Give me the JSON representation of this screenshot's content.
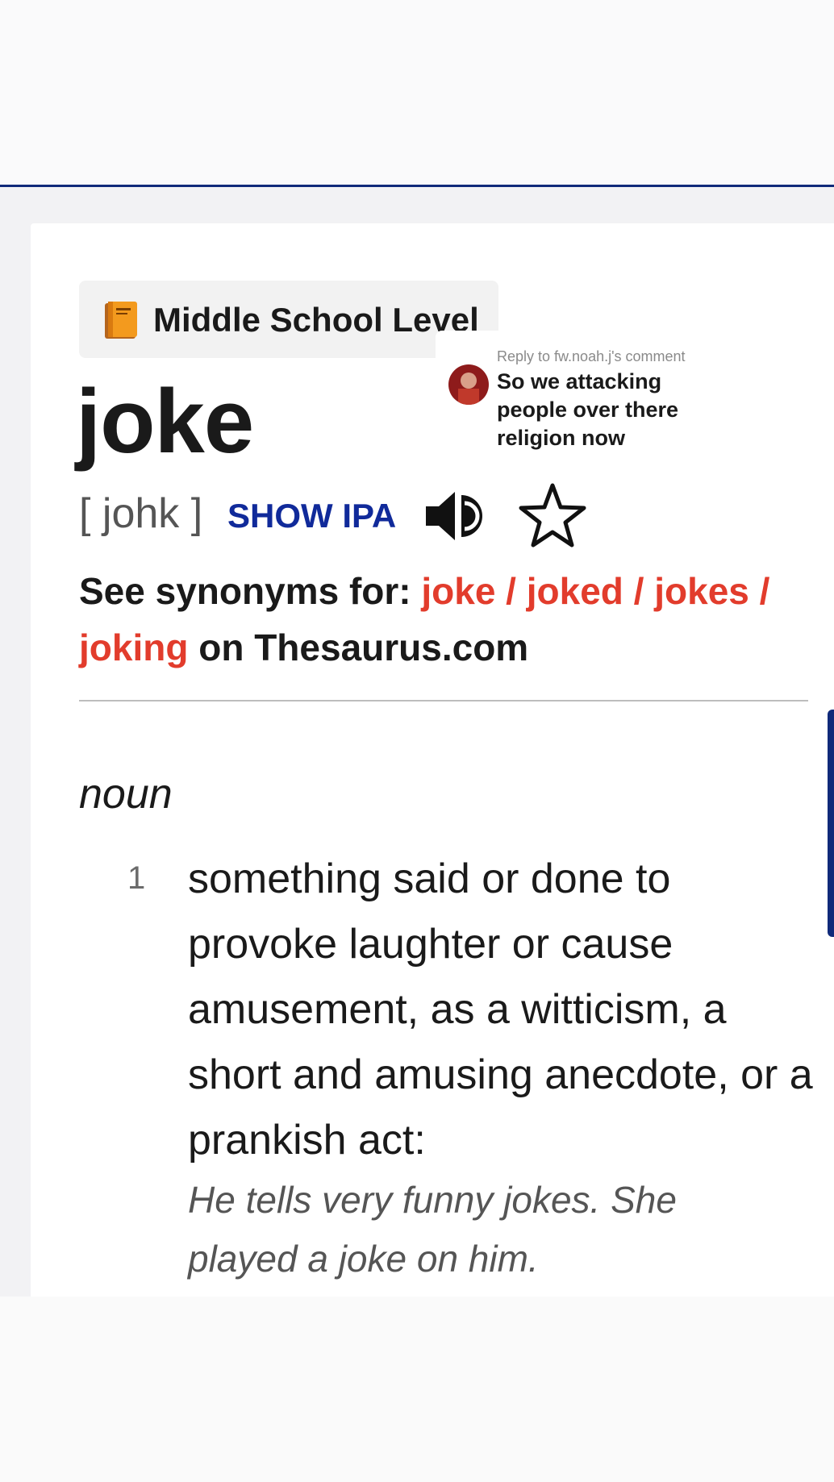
{
  "badge": {
    "level": "Middle School Level",
    "icon": "orange-book-icon"
  },
  "entry": {
    "word": "joke",
    "pronunciation": "[ johk ]",
    "show_ipa": "SHOW IPA"
  },
  "synonyms": {
    "prefix": "See synonyms for:",
    "words": [
      "joke",
      "joked",
      "jokes",
      "joking"
    ],
    "separator": " / ",
    "suffix": "on Thesaurus.com"
  },
  "definitions": {
    "part_of_speech": "noun",
    "items": [
      {
        "number": "1",
        "text": "something said or done to provoke laughter or cause amusement, as a witticism, a short and amusing anecdote, or a prankish act:",
        "example": "He tells very funny jokes. She played a joke on him."
      }
    ]
  },
  "comment_overlay": {
    "meta": "Reply to fw.noah.j's comment",
    "text": "So we attacking people over there religion now"
  },
  "colors": {
    "accent_blue": "#102a9a",
    "link_red": "#e23c2c",
    "header_rule": "#102a7a"
  },
  "icons": [
    "speaker-icon",
    "star-outline-icon",
    "orange-book-icon"
  ]
}
